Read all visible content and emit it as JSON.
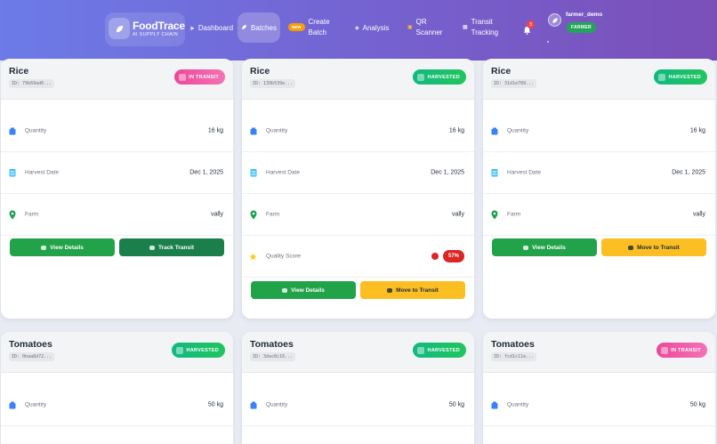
{
  "brand": {
    "name": "FoodTrace",
    "subtitle": "AI SUPPLY CHAIN",
    "icon": "leaf-icon"
  },
  "nav": {
    "dashboard": "Dashboard",
    "batches": "Batches",
    "new_badge": "NEW",
    "create_batch_1": "Create",
    "create_batch_2": "Batch",
    "analysis": "Analysis",
    "qr_1": "QR",
    "qr_2": "Scanner",
    "transit_1": "Transit",
    "transit_2": "Tracking",
    "notifications": "3"
  },
  "user": {
    "name": "farmer_demo",
    "role": "FARMER"
  },
  "labels": {
    "quantity": "Quantity",
    "harvest_date": "Harvest Date",
    "farm": "Farm",
    "quality_score": "Quality Score",
    "view_details": "View Details",
    "track_transit": "Track Transit",
    "move_to_transit": "Move to Transit"
  },
  "cards": [
    {
      "title": "Rice",
      "id": "ID: 79b69ad6...",
      "status": "IN TRANSIT",
      "quantity": "16 kg",
      "date": "Dec 1, 2025",
      "farm": "vally"
    },
    {
      "title": "Rice",
      "id": "ID: 139b539e...",
      "status": "HARVESTED",
      "quantity": "16 kg",
      "date": "Dec 1, 2025",
      "farm": "vally",
      "score": "57%"
    },
    {
      "title": "Rice",
      "id": "ID: 31d1e789...",
      "status": "HARVESTED",
      "quantity": "16 kg",
      "date": "Dec 1, 2025",
      "farm": "vally"
    },
    {
      "title": "Tomatoes",
      "id": "ID: 0baa8d72...",
      "status": "HARVESTED",
      "quantity": "50 kg"
    },
    {
      "title": "Tomatoes",
      "id": "ID: 3dac0c16...",
      "status": "HARVESTED",
      "quantity": "50 kg"
    },
    {
      "title": "Tomatoes",
      "id": "ID: fcd1c11e...",
      "status": "IN TRANSIT",
      "quantity": "50 kg"
    }
  ],
  "colors": {
    "harvested": "#10b981",
    "in_transit": "#ec4899",
    "primary_button": "#22a34a",
    "transit_button": "#fbbf24"
  }
}
